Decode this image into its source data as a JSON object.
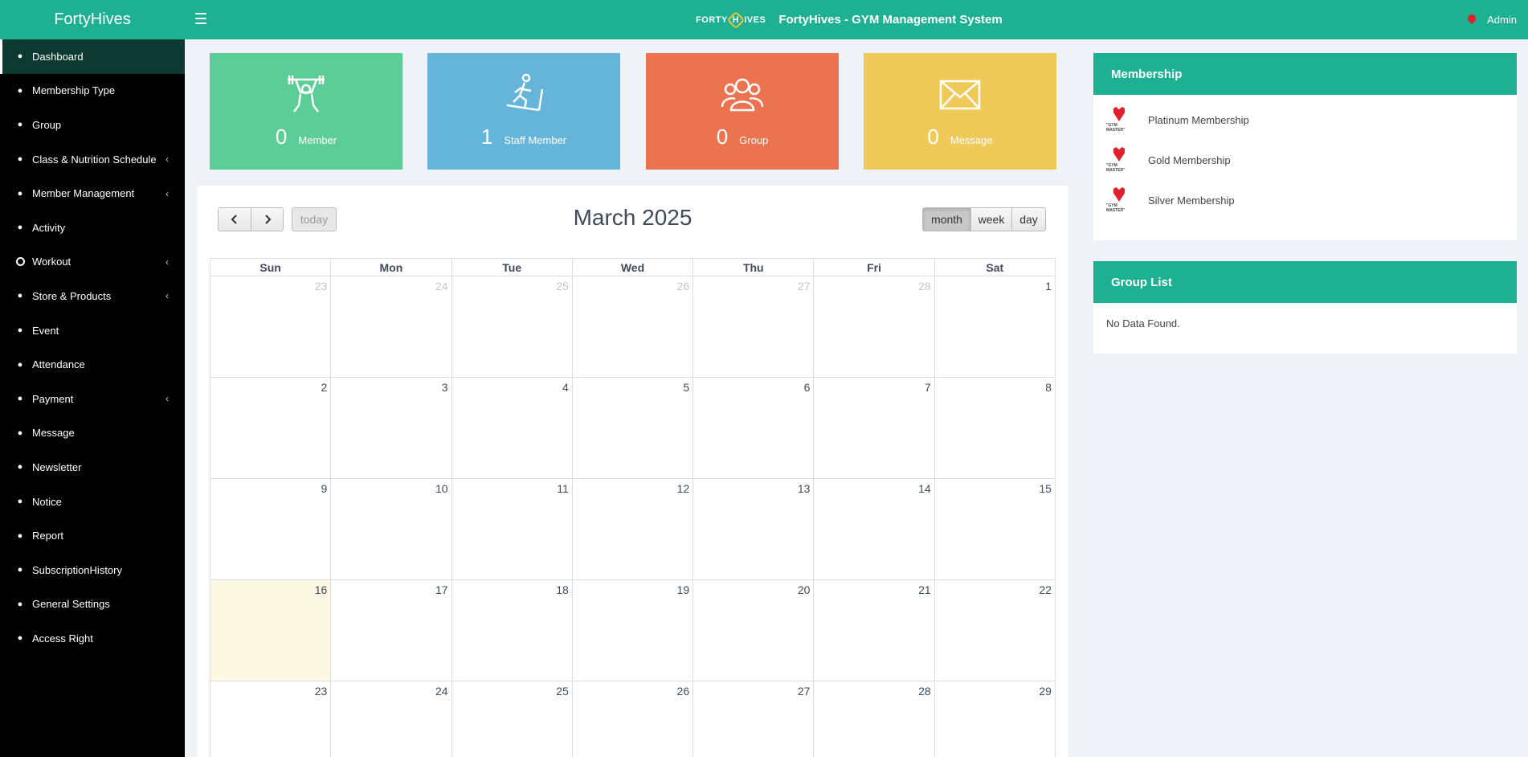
{
  "header": {
    "brand": "FortyHives",
    "logo_left": "FORTY",
    "logo_mid": "H",
    "logo_right": "IVES",
    "title": "FortyHives - GYM Management System",
    "user": "Admin"
  },
  "sidebar": {
    "items": [
      {
        "label": "Dashboard",
        "icon": "dashboard-icon",
        "active": true,
        "caret": false
      },
      {
        "label": "Membership Type",
        "icon": "users-icon",
        "caret": false
      },
      {
        "label": "Group",
        "icon": "group-icon",
        "caret": false
      },
      {
        "label": "Class & Nutrition Schedule",
        "icon": "calendar-icon",
        "caret": true
      },
      {
        "label": "Member Management",
        "icon": "user-icon",
        "caret": true
      },
      {
        "label": "Activity",
        "icon": "bicycle-icon",
        "caret": false
      },
      {
        "label": "Workout",
        "icon": "circle-icon",
        "caret": true
      },
      {
        "label": "Store & Products",
        "icon": "tags-icon",
        "caret": true
      },
      {
        "label": "Event",
        "icon": "ticket-icon",
        "caret": false
      },
      {
        "label": "Attendance",
        "icon": "attendance-icon",
        "caret": false
      },
      {
        "label": "Payment",
        "icon": "money-icon",
        "caret": true
      },
      {
        "label": "Message",
        "icon": "chat-icon",
        "caret": false
      },
      {
        "label": "Newsletter",
        "icon": "newsletter-icon",
        "caret": false
      },
      {
        "label": "Notice",
        "icon": "bell-icon",
        "caret": false
      },
      {
        "label": "Report",
        "icon": "report-icon",
        "caret": false
      },
      {
        "label": "SubscriptionHistory",
        "icon": "history-icon",
        "caret": false
      },
      {
        "label": "General Settings",
        "icon": "sliders-icon",
        "caret": false
      },
      {
        "label": "Access Right",
        "icon": "key-icon",
        "caret": false
      }
    ]
  },
  "stats": [
    {
      "value": "0",
      "label": "Member",
      "color": "#5ccd97",
      "icon": "weightlifter-icon"
    },
    {
      "value": "1",
      "label": "Staff Member",
      "color": "#65b4d9",
      "icon": "treadmill-icon"
    },
    {
      "value": "0",
      "label": "Group",
      "color": "#eb7350",
      "icon": "people-group-icon"
    },
    {
      "value": "0",
      "label": "Message",
      "color": "#efca58",
      "icon": "envelope-icon"
    }
  ],
  "calendar": {
    "title": "March 2025",
    "today_label": "today",
    "views": [
      "month",
      "week",
      "day"
    ],
    "active_view": "month",
    "weekdays": [
      "Sun",
      "Mon",
      "Tue",
      "Wed",
      "Thu",
      "Fri",
      "Sat"
    ],
    "weeks": [
      [
        [
          "23",
          true
        ],
        [
          "24",
          true
        ],
        [
          "25",
          true
        ],
        [
          "26",
          true
        ],
        [
          "27",
          true
        ],
        [
          "28",
          true
        ],
        [
          "1",
          false
        ]
      ],
      [
        [
          "2",
          false
        ],
        [
          "3",
          false
        ],
        [
          "4",
          false
        ],
        [
          "5",
          false
        ],
        [
          "6",
          false
        ],
        [
          "7",
          false
        ],
        [
          "8",
          false
        ]
      ],
      [
        [
          "9",
          false
        ],
        [
          "10",
          false
        ],
        [
          "11",
          false
        ],
        [
          "12",
          false
        ],
        [
          "13",
          false
        ],
        [
          "14",
          false
        ],
        [
          "15",
          false
        ]
      ],
      [
        [
          "16",
          false
        ],
        [
          "17",
          false
        ],
        [
          "18",
          false
        ],
        [
          "19",
          false
        ],
        [
          "20",
          false
        ],
        [
          "21",
          false
        ],
        [
          "22",
          false
        ]
      ],
      [
        [
          "23",
          false
        ],
        [
          "24",
          false
        ],
        [
          "25",
          false
        ],
        [
          "26",
          false
        ],
        [
          "27",
          false
        ],
        [
          "28",
          false
        ],
        [
          "29",
          false
        ]
      ]
    ],
    "today_date": "16"
  },
  "membership": {
    "title": "Membership",
    "logo_text": "\"GYM MASTER\"",
    "items": [
      "Platinum Membership",
      "Gold Membership",
      "Silver Membership"
    ]
  },
  "group_list": {
    "title": "Group List",
    "empty": "No Data Found."
  }
}
